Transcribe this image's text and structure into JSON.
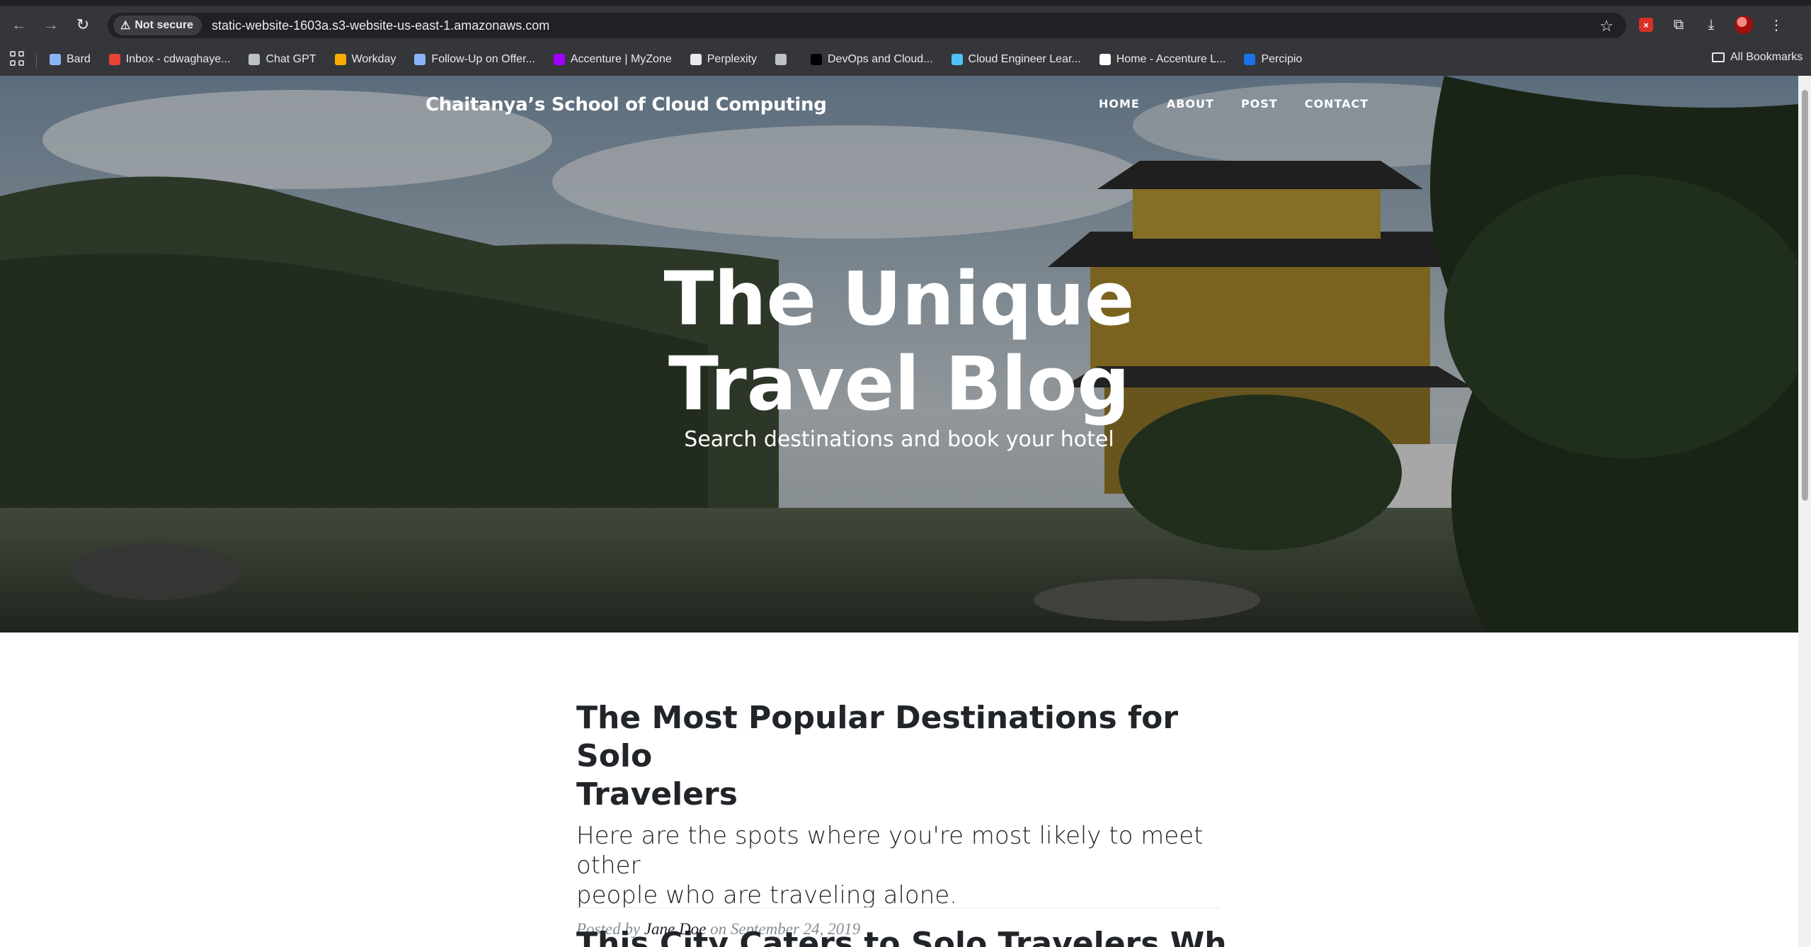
{
  "browser": {
    "security_label": "Not secure",
    "url": "static-website-1603a.s3-website-us-east-1.amazonaws.com",
    "bookmarks": [
      {
        "label": "Bard",
        "color": "#8ab4f8"
      },
      {
        "label": "Inbox - cdwaghaye...",
        "color": "#ea4335"
      },
      {
        "label": "Chat GPT",
        "color": "#bdc1c6"
      },
      {
        "label": "Workday",
        "color": "#f9ab00"
      },
      {
        "label": "Follow-Up on Offer...",
        "color": "#8ab4f8"
      },
      {
        "label": "Accenture | MyZone",
        "color": "#a100ff"
      },
      {
        "label": "Perplexity",
        "color": "#e8eaed"
      },
      {
        "label": "",
        "color": "#bdc1c6"
      },
      {
        "label": "DevOps and Cloud...",
        "color": "#000000"
      },
      {
        "label": "Cloud Engineer Lear...",
        "color": "#4fc3f7"
      },
      {
        "label": "Home - Accenture L...",
        "color": "#ffffff"
      },
      {
        "label": "Percipio",
        "color": "#1a73e8"
      }
    ],
    "all_bookmarks_label": "All Bookmarks"
  },
  "site": {
    "brand": "Chaitanya’s School of Cloud Computing",
    "nav": [
      "HOME",
      "ABOUT",
      "POST",
      "CONTACT"
    ]
  },
  "hero": {
    "title_line1": "The Unique",
    "title_line2": "Travel Blog",
    "subtitle": "Search destinations and book your hotel"
  },
  "posts": [
    {
      "title_line1": "The Most Popular Destinations for Solo",
      "title_line2": "Travelers",
      "subtitle_line1": "Here are the spots where you're most likely to meet other",
      "subtitle_line2": "people who are traveling alone.",
      "posted_by": "Posted by",
      "author": "Jane Doe",
      "on": "on",
      "date": "September 24, 2019"
    },
    {
      "title_partial": "This City Caters to Solo Travelers Wh"
    }
  ]
}
